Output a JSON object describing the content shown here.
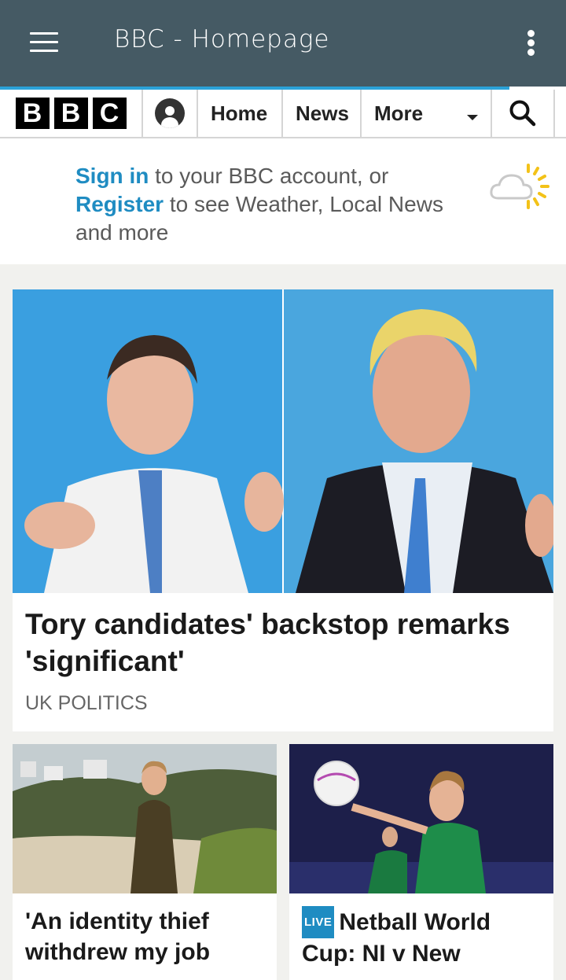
{
  "app_bar": {
    "title": "BBC  -  Homepage",
    "menu_icon": "hamburger-menu-icon",
    "overflow_icon": "more-vert-icon",
    "load_progress": 0.9
  },
  "nav": {
    "logo_letters": [
      "B",
      "B",
      "C"
    ],
    "account_icon": "account-icon",
    "home_label": "Home",
    "news_label": "News",
    "more_label": "More",
    "search_icon": "search-icon"
  },
  "signin_banner": {
    "signin_link": "Sign in",
    "text_after_signin": " to your BBC account, or",
    "register_link": "Register",
    "text_after_register": " to see Weather, Local News and more",
    "weather_icon": "weather-cloud-sun-icon"
  },
  "lead_story": {
    "headline": "Tory candidates' backstop remarks 'significant'",
    "tag": "UK POLITICS"
  },
  "stories": [
    {
      "headline": "'An identity thief withdrew my job",
      "live": ""
    },
    {
      "headline": "Netball World Cup: NI v New",
      "live": "LIVE"
    }
  ],
  "colors": {
    "app_bar": "#455a64",
    "progress": "#2ba2d8",
    "link_blue": "#1f8cc2",
    "page_bg": "#f1f1ee"
  }
}
